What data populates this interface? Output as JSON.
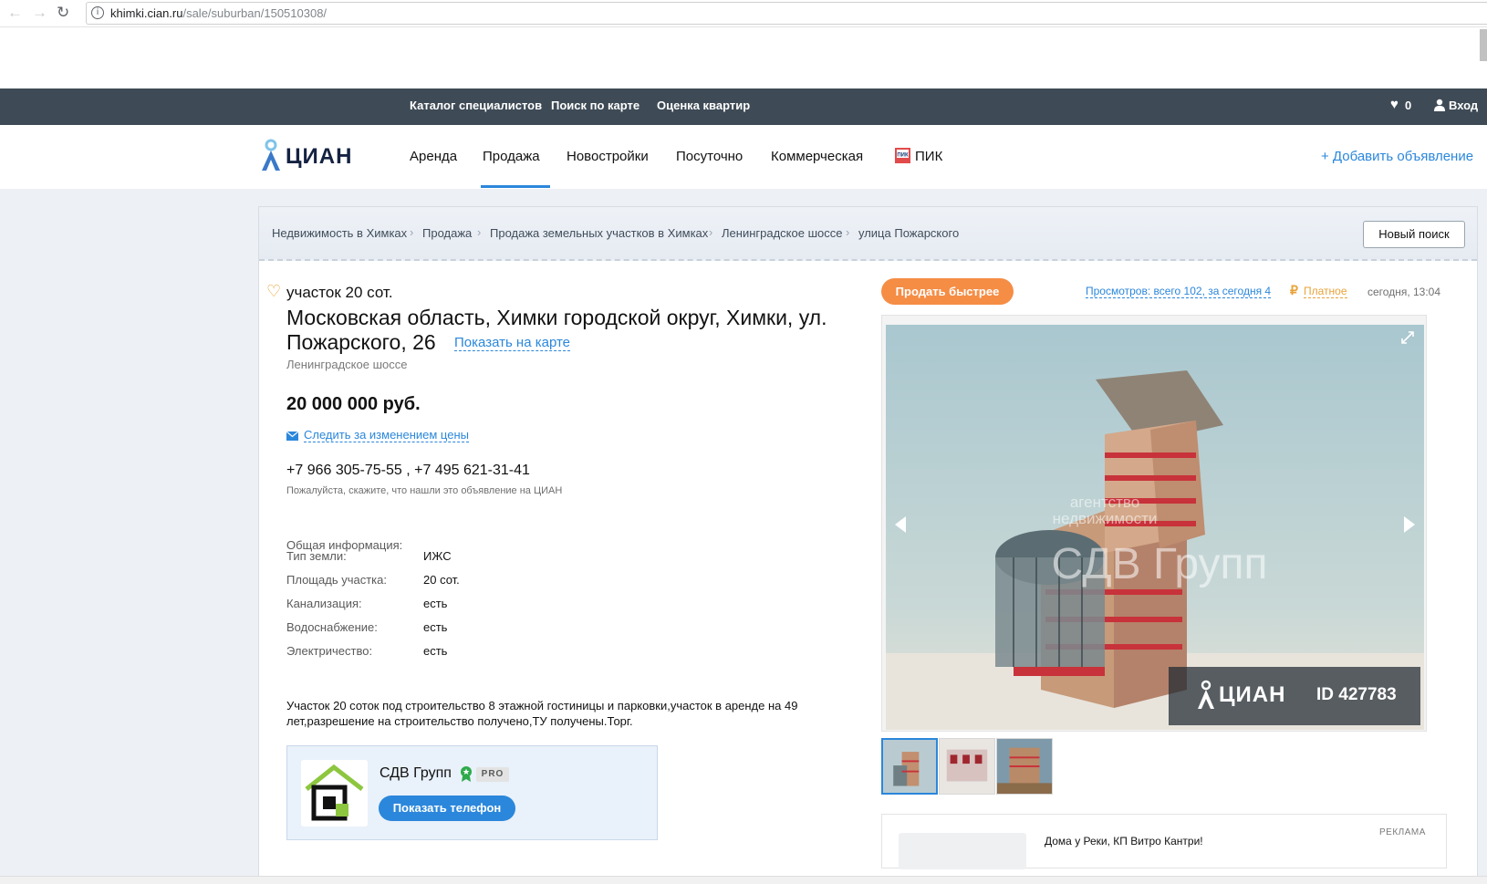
{
  "browser": {
    "back": "←",
    "forward": "→",
    "reload": "↻",
    "url_host": "khimki.cian.ru",
    "url_path": "/sale/suburban/150510308/"
  },
  "topbar": {
    "links": [
      "Каталог специалистов",
      "Поиск по карте",
      "Оценка квартир"
    ],
    "favorites_count": "0",
    "login": "Вход"
  },
  "header": {
    "logo_text": "ЦИАН",
    "nav": [
      "Аренда",
      "Продажа",
      "Новостройки",
      "Посуточно",
      "Коммерческая",
      "ПИК"
    ],
    "active_nav": "Продажа",
    "add_listing": "+ Добавить объявление",
    "accent_color": "#2b87db"
  },
  "breadcrumbs": [
    "Недвижимость в Химках",
    "Продажа",
    "Продажа земельных участков в Химках",
    "Ленинградское шоссе",
    "улица Пожарского"
  ],
  "new_search": "Новый поиск",
  "listing": {
    "type": "участок 20 сот.",
    "address_line1": "Московская область, Химки городской округ, Химки, ул.",
    "address_line2": "Пожарского, 26",
    "show_on_map": "Показать на карте",
    "highway": "Ленинградское шоссе",
    "price": "20 000 000 руб.",
    "follow_price": "Следить за изменением цены",
    "phones": "+7 966 305-75-55 , +7 495 621-31-41",
    "phones_note": "Пожалуйста, скажите, что нашли это объявление на ЦИАН",
    "info_heading": "Общая информация:",
    "info": [
      {
        "label": "Тип земли:",
        "value": "ИЖС"
      },
      {
        "label": "Площадь участка:",
        "value": "20 сот."
      },
      {
        "label": "Канализация:",
        "value": "есть"
      },
      {
        "label": "Водоснабжение:",
        "value": "есть"
      },
      {
        "label": "Электричество:",
        "value": "есть"
      }
    ],
    "description": "Участок 20 соток под строительство 8 этажной гостиницы и парковки,участок в аренде на 49 лет,разрешение на строительство получено,ТУ получены.Торг."
  },
  "agent": {
    "name": "СДВ Групп",
    "badge": "PRO",
    "show_phone": "Показать телефон"
  },
  "sidebar": {
    "sell_faster": "Продать быстрее",
    "views": "Просмотров: всего 102, за сегодня 4",
    "paid": "Платное",
    "date": "сегодня, 13:04"
  },
  "gallery": {
    "photo_id": "ID 427783",
    "watermark_logo": "ЦИАН",
    "thumbnail_count": 3
  },
  "ad": {
    "label": "РЕКЛАМА",
    "title": "Дома у Реки, КП Витро Кантри!"
  },
  "icons": [
    "back-icon",
    "forward-icon",
    "reload-icon",
    "info-icon",
    "heart-icon",
    "user-icon",
    "pik-icon",
    "mail-icon",
    "ruble-icon",
    "expand-icon",
    "arrow-prev-icon",
    "arrow-next-icon"
  ]
}
